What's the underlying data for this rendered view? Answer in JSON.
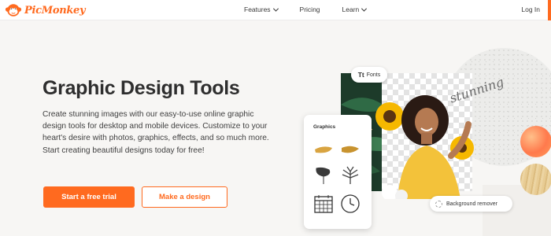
{
  "nav": {
    "brand": "PicMonkey",
    "links": [
      {
        "label": "Features",
        "has_dropdown": true
      },
      {
        "label": "Pricing",
        "has_dropdown": false
      },
      {
        "label": "Learn",
        "has_dropdown": true
      }
    ],
    "login": "Log In",
    "accent": "#ff6a1f"
  },
  "hero": {
    "title": "Graphic Design Tools",
    "description": "Create stunning images with our easy-to-use online graphic design tools for desktop and mobile devices. Customize to your heart's desire with photos, graphics, effects, and so much more. Start creating beautiful designs today for free!",
    "primary_cta": "Start a free trial",
    "secondary_cta": "Make a design"
  },
  "collage": {
    "fonts_chip": {
      "glyph": "Tt",
      "label": "Fonts"
    },
    "graphics_card_label": "Graphics",
    "graphics_icons": [
      "gold-brushstroke-icon",
      "gold-brushstroke-icon",
      "monstera-leaf-icon",
      "palm-leaf-icon",
      "calendar-icon",
      "clock-icon"
    ],
    "background_remover_label": "Background remover",
    "script_text": "stunning",
    "swatch_colors": [
      "#ff8a55",
      "#e3c48a"
    ]
  }
}
